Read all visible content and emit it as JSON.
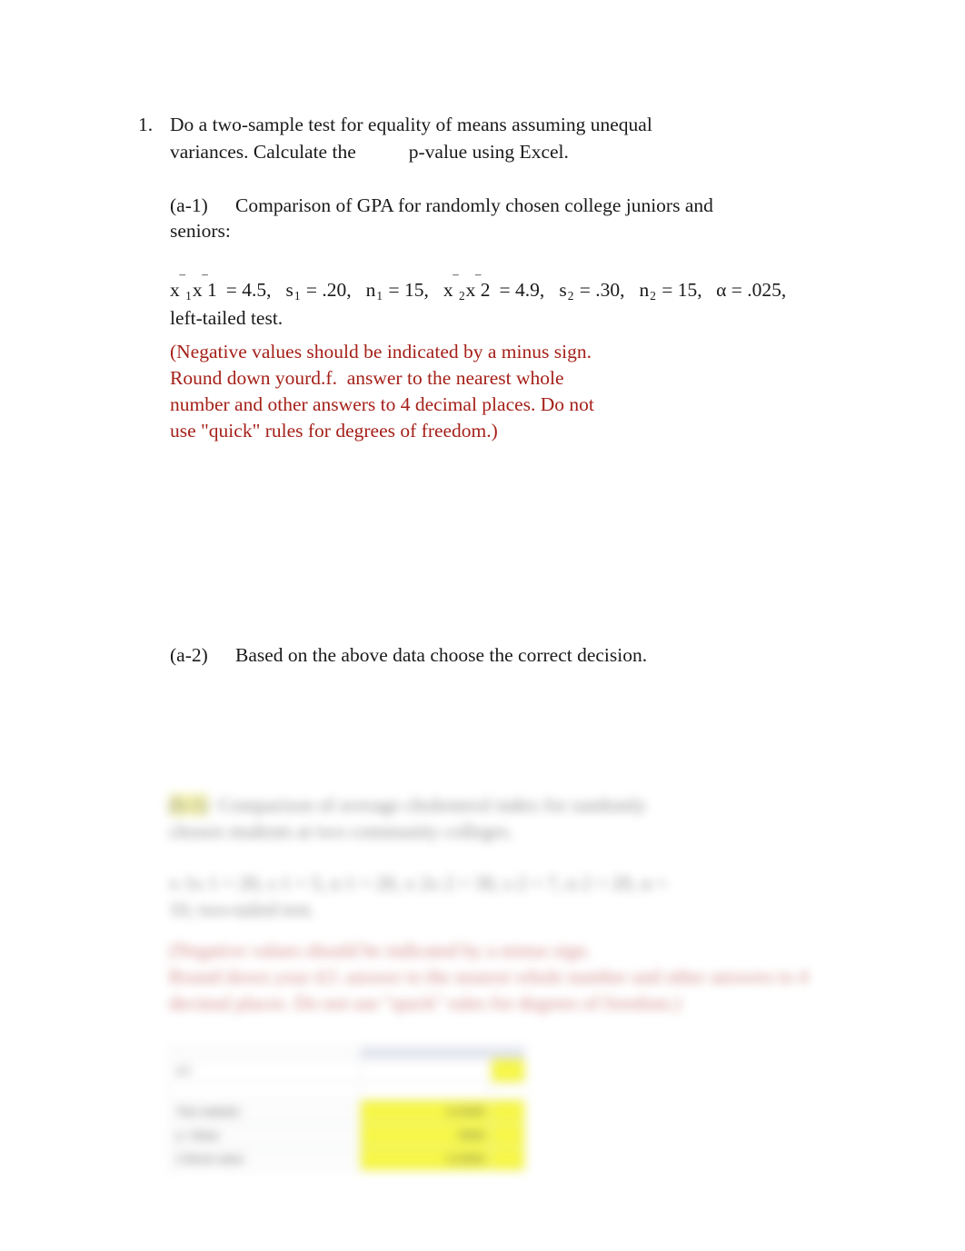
{
  "document": {
    "type": "homework-question",
    "background_color": "#ffffff",
    "text_color": "#1a1a1a",
    "note_color": "#a52019",
    "highlight_color": "#f3f30c",
    "table_header_color": "#d6dae7"
  },
  "question": {
    "number": "1.",
    "stem_part_1": "Do a two-sample test for equality of means assuming unequal variances. Calculate the",
    "stem_part_2": "p",
    "stem_part_3": "-value using Excel."
  },
  "part_a1": {
    "tag": "(a-1)",
    "prompt": "Comparison of GPA for randomly chosen college juniors and seniors:",
    "givens": {
      "mean1_symbol": "x",
      "mean1_sub": "1",
      "mean1_repeat_symbol": "x",
      "mean1_repeat_sub": "1",
      "mean1_value": "= 4.5,",
      "s1_symbol": "s",
      "s1_sub": "1",
      "s1_value": "= .20,",
      "n1_symbol": "n",
      "n1_sub": "1",
      "n1_value": "= 15,",
      "mean2_symbol": "x",
      "mean2_sub": "2",
      "mean2_repeat_symbol": "x",
      "mean2_repeat_sub": "2",
      "mean2_value": "= 4.9,",
      "s2_symbol": "s",
      "s2_sub": "2",
      "s2_value": "= .30,",
      "n2_symbol": "n",
      "n2_sub": "2",
      "n2_value": "= 15,",
      "alpha_symbol": "α",
      "alpha_value": "= .025, left-tailed test."
    },
    "note_lines": [
      "(Negative values should be indicated by a minus sign.",
      "Round down your",
      "d.f.",
      "answer to the nearest whole",
      "number and other answers to 4 decimal places. Do not",
      "use \"quick\" rules for degrees of freedom.)"
    ]
  },
  "part_a2": {
    "tag": "(a-2)",
    "prompt": "Based on the above data choose the correct decision."
  },
  "redacted_block": {
    "description": "blurred duplicate question block (part b)",
    "line_1_highlight": "(b-1)",
    "line_1": "Comparison of average cholesterol index for randomly",
    "line_2": "chosen students at two community colleges.",
    "givens_line_1": "x 1x 1 = 20, s 1 = 5, n 1 = 20, x 2x 2 = 30, s 2 = 7, n 2 = 20, α =",
    "givens_line_2": "10, two-tailed test.",
    "note_line_1": "(Negative values should be indicated by a minus sign.",
    "note_line_2": "Round down your d.f. answer to the nearest whole",
    "note_line_3": "number and other answers to 4 decimal places. Do not",
    "note_line_4": "use \"quick\" rules for degrees of freedom.)"
  },
  "redacted_table": {
    "description": "blurred answer-entry table with yellow highlighted answer cells",
    "header": "",
    "rows": [
      {
        "label": "d.f.",
        "value": "",
        "highlight": true
      },
      {
        "label": "",
        "value": "",
        "highlight": false
      },
      {
        "label": "Test statistic",
        "value": "-0.0000",
        "unit": "",
        "highlight": true
      },
      {
        "label": "p -Value",
        "value": "0000",
        "unit": "",
        "highlight": true
      },
      {
        "label": "Critical value",
        "value": "-0.0000",
        "unit": "",
        "highlight": true
      }
    ]
  }
}
